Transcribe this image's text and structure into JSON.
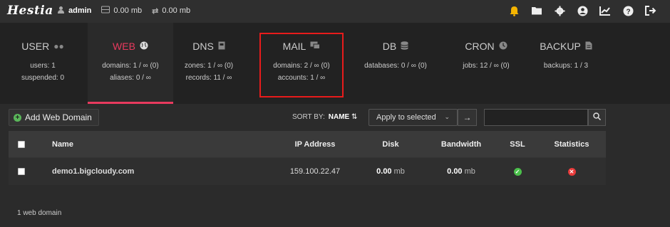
{
  "brand": {
    "logo": "Hestia"
  },
  "top_stats": {
    "user": "admin",
    "disk": "0.00 mb",
    "bandwidth": "0.00 mb"
  },
  "top_icons": [
    "bell-icon",
    "folder-icon",
    "gear-icon",
    "user-circle-icon",
    "chart-icon",
    "help-icon",
    "logout-icon"
  ],
  "tabs": [
    {
      "title": "USER",
      "icon": "users-icon",
      "line1": "users: 1",
      "line2": "suspended: 0"
    },
    {
      "title": "WEB",
      "icon": "globe-icon",
      "line1": "domains: 1 / ∞ (0)",
      "line2": "aliases: 0 / ∞"
    },
    {
      "title": "DNS",
      "icon": "book-icon",
      "line1": "zones: 1 / ∞ (0)",
      "line2": "records: 11 / ∞"
    },
    {
      "title": "MAIL",
      "icon": "mail-icon",
      "line1": "domains: 2 / ∞ (0)",
      "line2": "accounts: 1 / ∞"
    },
    {
      "title": "DB",
      "icon": "database-icon",
      "line1": "databases: 0 / ∞ (0)",
      "line2": ""
    },
    {
      "title": "CRON",
      "icon": "clock-icon",
      "line1": "jobs: 12 / ∞ (0)",
      "line2": ""
    },
    {
      "title": "BACKUP",
      "icon": "file-icon",
      "line1": "backups: 1 / 3",
      "line2": ""
    }
  ],
  "toolbar": {
    "add_label": "Add Web Domain",
    "sort_label": "SORT BY:",
    "sort_value": "NAME",
    "apply_label": "Apply to selected",
    "search_placeholder": ""
  },
  "table": {
    "headers": {
      "name": "Name",
      "ip": "IP Address",
      "disk": "Disk",
      "bandwidth": "Bandwidth",
      "ssl": "SSL",
      "stats": "Statistics"
    },
    "rows": [
      {
        "name": "demo1.bigcloudy.com",
        "ip": "159.100.22.47",
        "disk_value": "0.00",
        "disk_unit": "mb",
        "bw_value": "0.00",
        "bw_unit": "mb",
        "ssl": "enabled",
        "stats": "disabled"
      }
    ]
  },
  "footer": {
    "summary": "1 web domain"
  },
  "colors": {
    "accent": "#e83a5e",
    "ok": "#4bc04b",
    "bad": "#e83a3a",
    "highlight": "#e81b1b"
  }
}
